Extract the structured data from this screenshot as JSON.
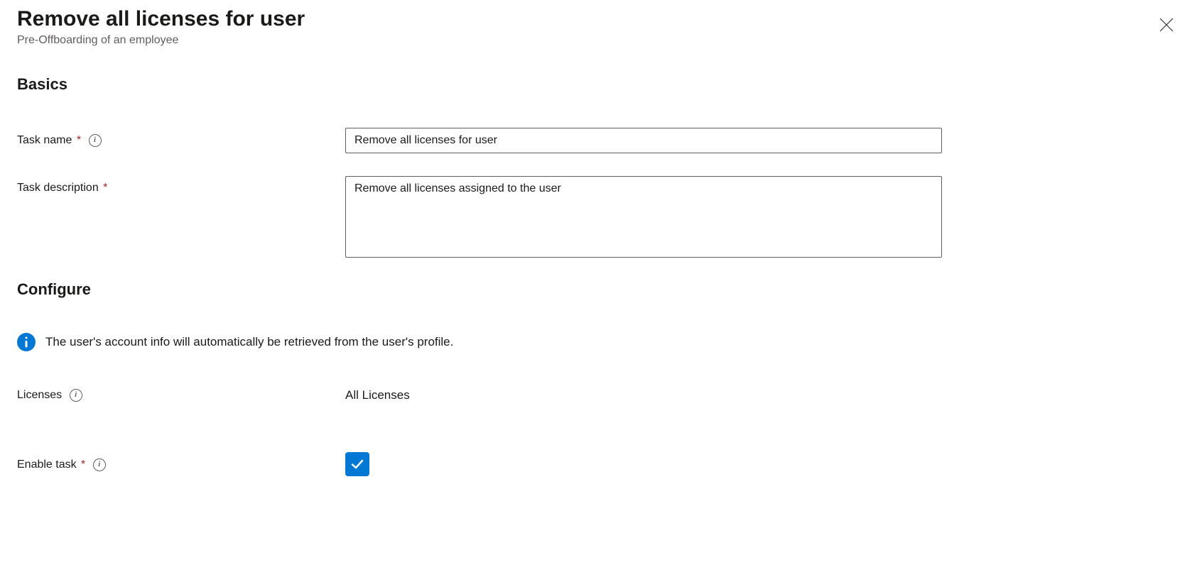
{
  "header": {
    "title": "Remove all licenses for user",
    "subtitle": "Pre-Offboarding of an employee"
  },
  "sections": {
    "basics": {
      "title": "Basics",
      "task_name_label": "Task name",
      "task_name_value": "Remove all licenses for user",
      "task_description_label": "Task description",
      "task_description_value": "Remove all licenses assigned to the user"
    },
    "configure": {
      "title": "Configure",
      "info_text": "The user's account info will automatically be retrieved from the user's profile.",
      "licenses_label": "Licenses",
      "licenses_value": "All Licenses",
      "enable_task_label": "Enable task",
      "enable_task_checked": true
    }
  }
}
